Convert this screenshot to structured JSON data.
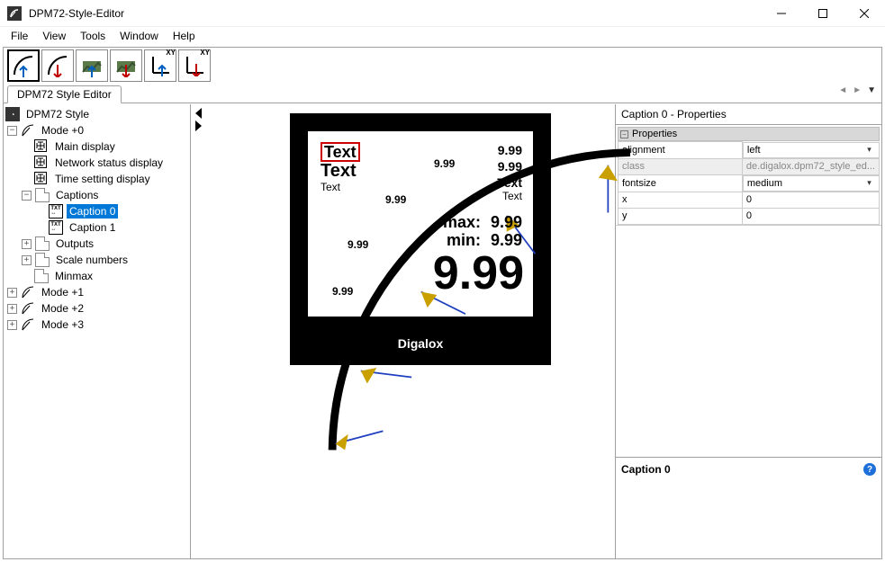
{
  "window": {
    "title": "DPM72-Style-Editor"
  },
  "menu": {
    "file": "File",
    "view": "View",
    "tools": "Tools",
    "window": "Window",
    "help": "Help"
  },
  "toolbar": {
    "xy1": "XY",
    "xy2": "XY"
  },
  "tabs": {
    "main": "DPM72 Style Editor"
  },
  "tree": {
    "root": "DPM72 Style",
    "mode0": "Mode +0",
    "main_display": "Main display",
    "network_status": "Network status display",
    "time_setting": "Time setting display",
    "captions": "Captions",
    "caption0": "Caption 0",
    "caption1": "Caption 1",
    "outputs": "Outputs",
    "scale_numbers": "Scale numbers",
    "minmax": "Minmax",
    "mode1": "Mode +1",
    "mode2": "Mode +2",
    "mode3": "Mode +3"
  },
  "preview": {
    "brand": "Digalox",
    "text1": "Text",
    "text2": "Text",
    "text3": "Text",
    "r999a": "9.99",
    "r999b": "9.99",
    "rt1": "Text",
    "rt2": "Text",
    "maxl": "max:",
    "maxv": "9.99",
    "minl": "min:",
    "minv": "9.99",
    "big": "9.99",
    "tick1": "9.99",
    "tick2": "9.99",
    "tick3": "9.99"
  },
  "props": {
    "title": "Caption 0 - Properties",
    "group": "Properties",
    "alignment_k": "alignment",
    "alignment_v": "left",
    "class_k": "class",
    "class_v": "de.digalox.dpm72_style_ed...",
    "fontsize_k": "fontsize",
    "fontsize_v": "medium",
    "x_k": "x",
    "x_v": "0",
    "y_k": "y",
    "y_v": "0",
    "caption_label": "Caption 0"
  }
}
